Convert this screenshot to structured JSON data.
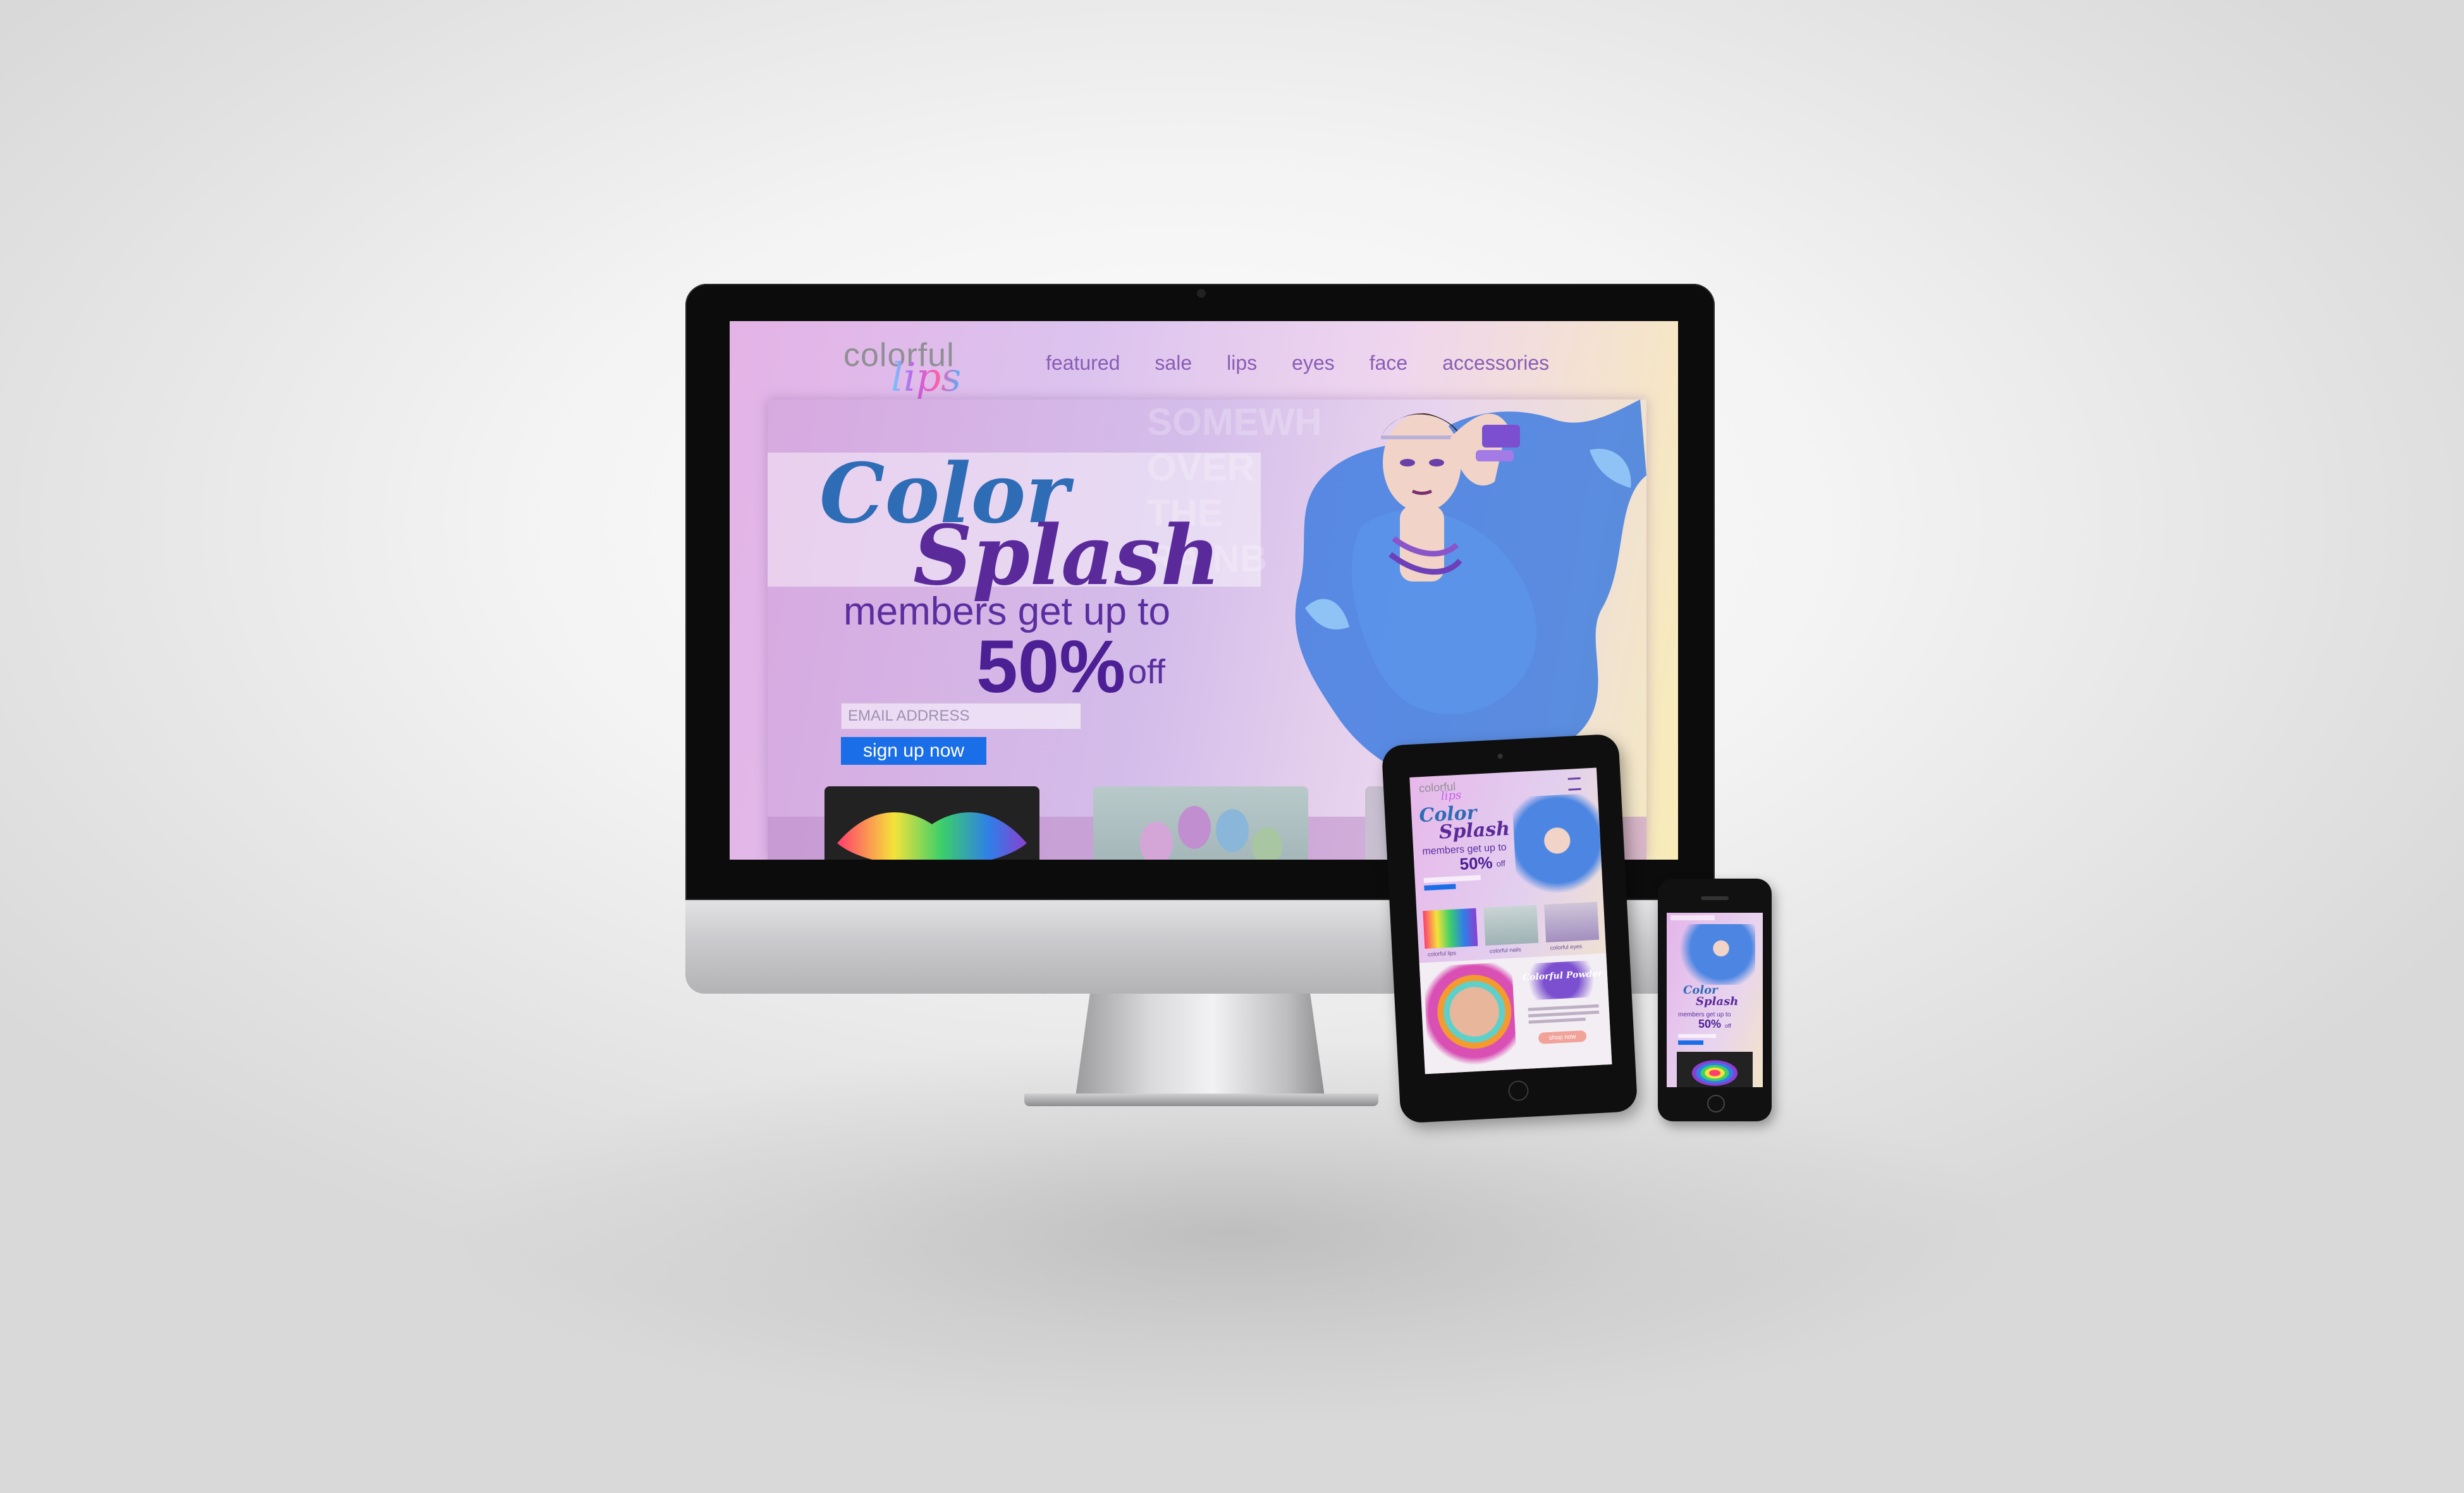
{
  "desktop": {
    "logo": {
      "top": "colorful",
      "script": "lips"
    },
    "nav": [
      "featured",
      "sale",
      "lips",
      "eyes",
      "face",
      "accessories"
    ],
    "hero": {
      "ghost_words": [
        "SOMEWH",
        "OVER",
        "THE",
        "RAINB",
        "",
        "",
        "RAINB"
      ],
      "title_line1": "Color",
      "title_line2": "Splash",
      "promo_line": "members get up to",
      "promo_pct": "50%",
      "promo_off": "off",
      "email_placeholder": "EMAIL ADDRESS",
      "signup_label": "sign up now"
    }
  },
  "tablet": {
    "logo": {
      "top": "colorful",
      "script": "lips"
    },
    "title_line1": "Color",
    "title_line2": "Splash",
    "promo_line": "members get up to",
    "promo_pct": "50%",
    "promo_off": "off",
    "thumbs": [
      "colorful lips",
      "colorful nails",
      "colorful eyes"
    ],
    "feature_title": "Colorful Powder",
    "feature_button": "shop now"
  },
  "phone": {
    "title_line1": "Color",
    "title_line2": "Splash",
    "promo_line": "members get up to",
    "promo_pct": "50%",
    "promo_off": "off"
  },
  "colors": {
    "accent": "#5b2ea0",
    "signup": "#1a6ee8",
    "nav": "#8a5db5"
  }
}
